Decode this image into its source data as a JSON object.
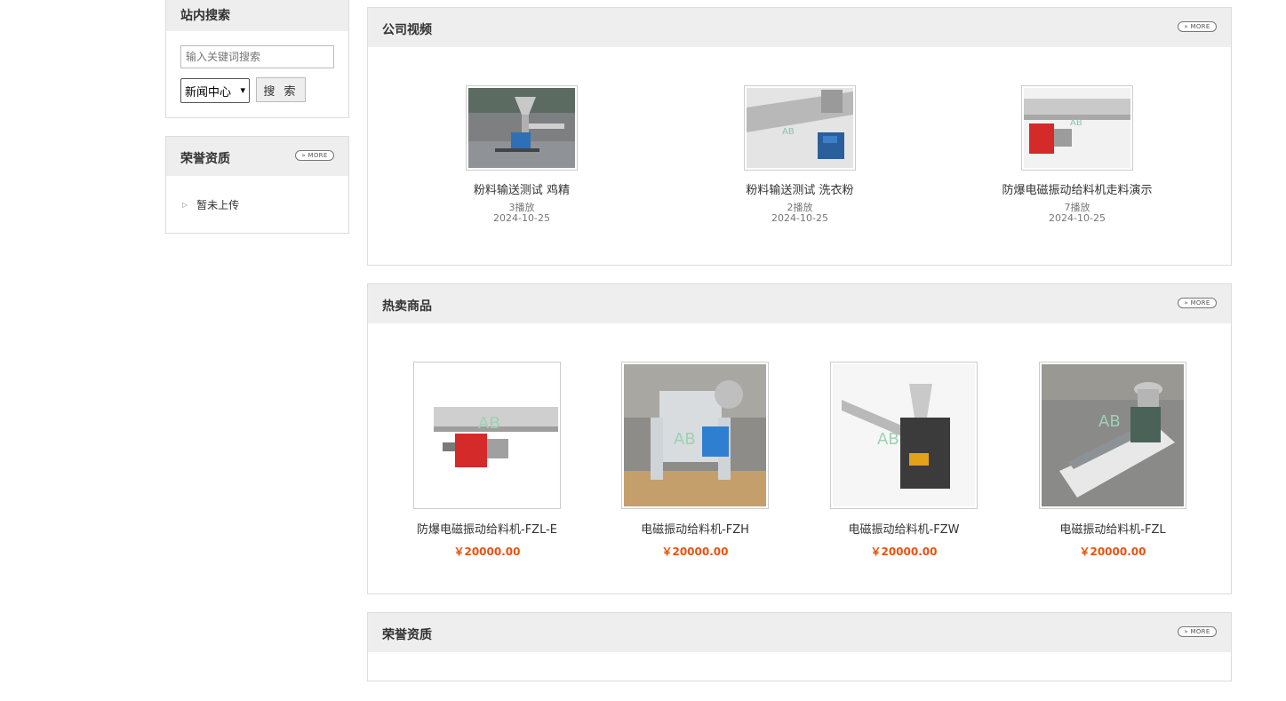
{
  "sidebar": {
    "search": {
      "title": "站内搜索",
      "placeholder": "输入关键词搜索",
      "select_value": "新闻中心",
      "button": "搜 索"
    },
    "honor": {
      "title": "荣誉资质",
      "more": "MORE",
      "items": [
        {
          "label": "暂未上传"
        }
      ]
    }
  },
  "videos": {
    "title": "公司视频",
    "more": "MORE",
    "items": [
      {
        "name": "粉料输送测试 鸡精",
        "plays": "3播放",
        "date": "2024-10-25"
      },
      {
        "name": "粉料输送测试 洗衣粉",
        "plays": "2播放",
        "date": "2024-10-25"
      },
      {
        "name": "防爆电磁振动给料机走料演示",
        "plays": "7播放",
        "date": "2024-10-25"
      }
    ]
  },
  "products": {
    "title": "热卖商品",
    "more": "MORE",
    "items": [
      {
        "name": "防爆电磁振动给料机-FZL-E",
        "price": "￥20000.00"
      },
      {
        "name": "电磁振动给料机-FZH",
        "price": "￥20000.00"
      },
      {
        "name": "电磁振动给料机-FZW",
        "price": "￥20000.00"
      },
      {
        "name": "电磁振动给料机-FZL",
        "price": "￥20000.00"
      }
    ]
  },
  "honor_main": {
    "title": "荣誉资质",
    "more": "MORE"
  },
  "colors": {
    "header_bg": "#eeeeee",
    "border": "#dcdcdc",
    "price": "#e4540f"
  }
}
